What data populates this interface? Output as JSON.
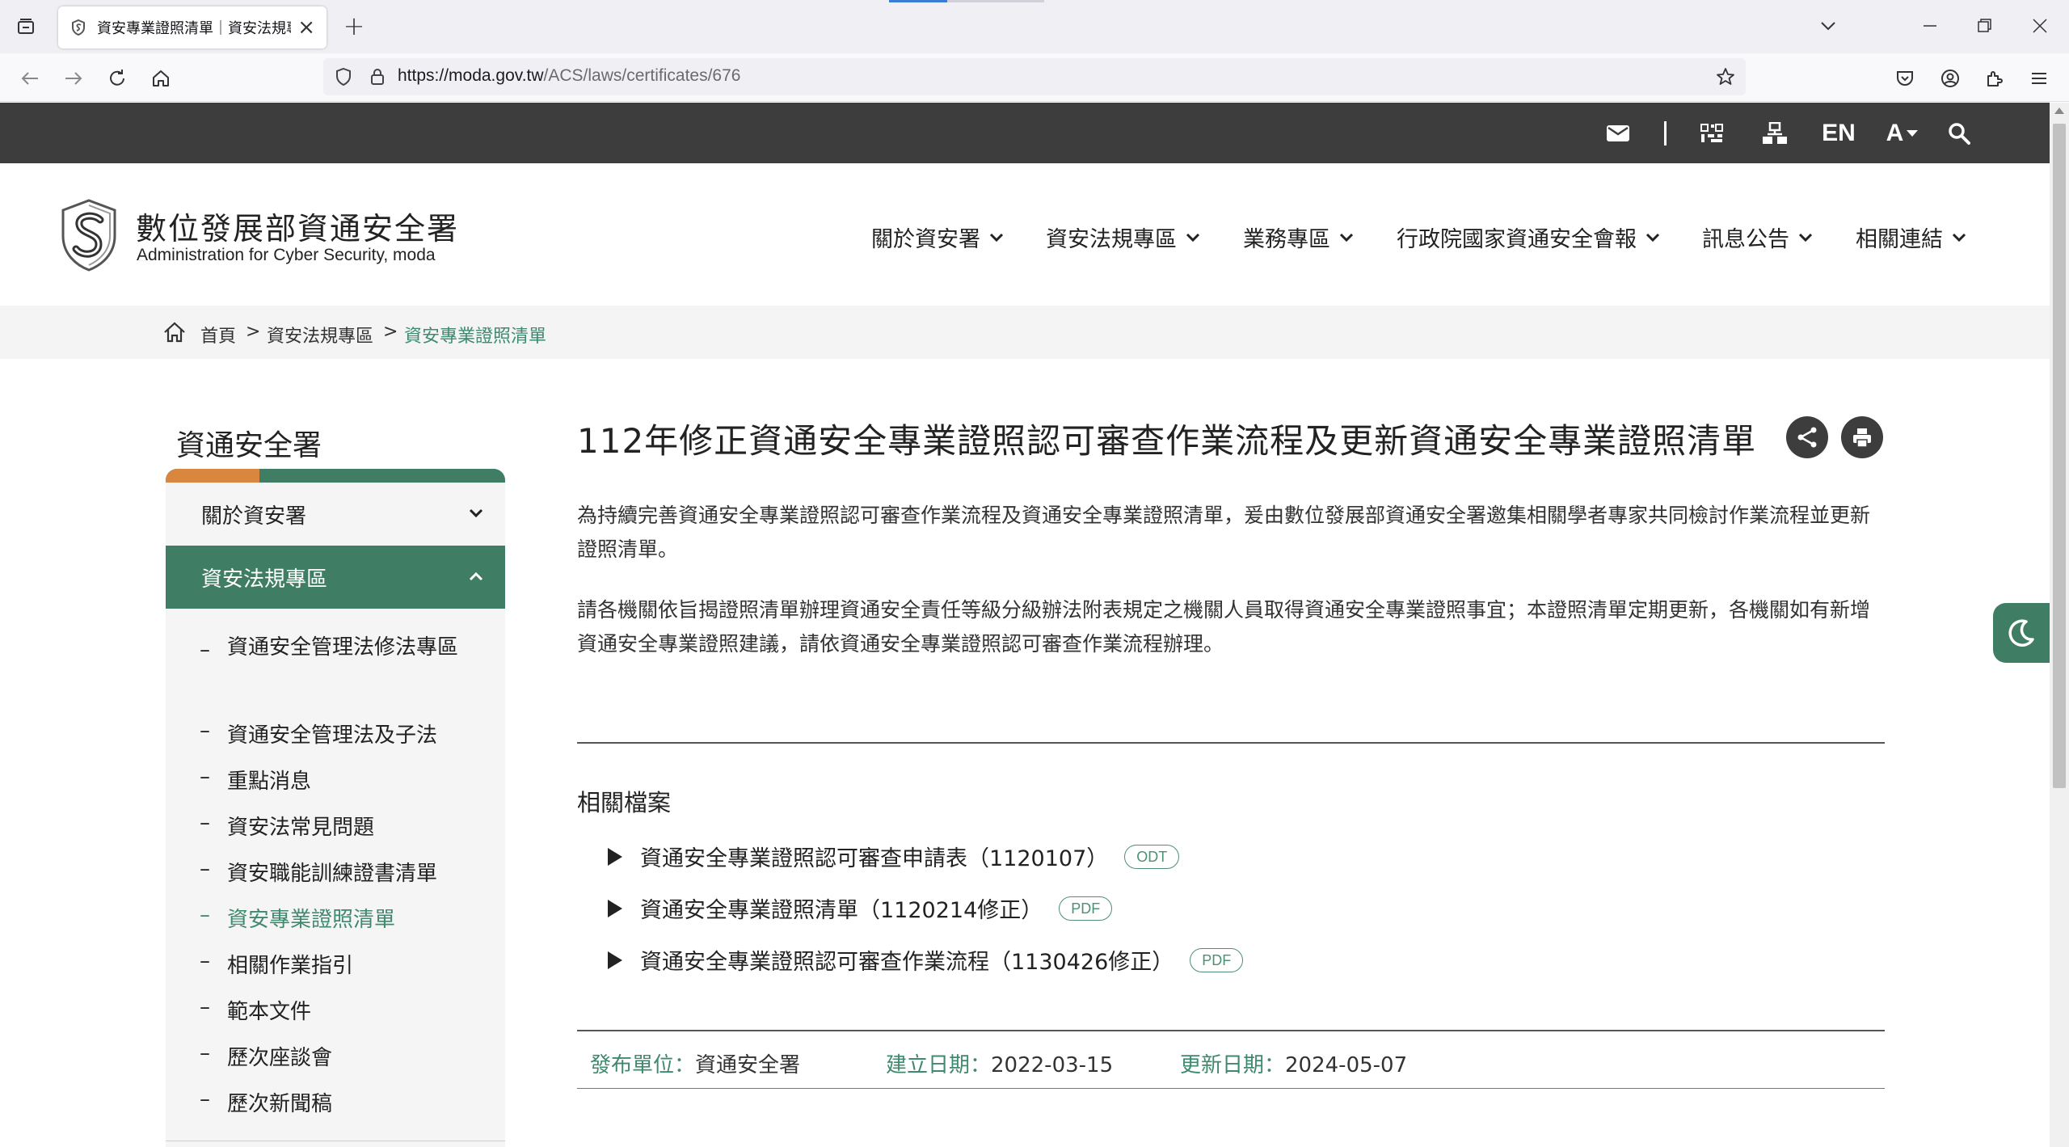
{
  "browser": {
    "tab_title": "資安專業證照清單｜資安法規專區",
    "tab_close": "×",
    "new_tab": "+",
    "url_host": "https://moda.gov.tw",
    "url_path": "/ACS/laws/certificates/676"
  },
  "topbar": {
    "lang": "EN",
    "font_size": "A"
  },
  "header": {
    "brand_zh": "數位發展部資通安全署",
    "brand_en": "Administration for Cyber Security, moda",
    "nav": [
      {
        "label": "關於資安署"
      },
      {
        "label": "資安法規專區"
      },
      {
        "label": "業務專區"
      },
      {
        "label": "行政院國家資通安全會報"
      },
      {
        "label": "訊息公告"
      },
      {
        "label": "相關連結"
      }
    ]
  },
  "breadcrumb": {
    "items": [
      "首頁",
      "資安法規專區",
      "資安專業證照清單"
    ],
    "separator": ">"
  },
  "sidebar": {
    "title": "資通安全署",
    "sections": [
      {
        "label": "關於資安署",
        "expanded": false
      },
      {
        "label": "資安法規專區",
        "expanded": true
      }
    ],
    "sub_items": [
      {
        "label": "資通安全管理法修法專區",
        "active": false
      },
      {
        "label": "資通安全管理法及子法",
        "active": false
      },
      {
        "label": "重點消息",
        "active": false
      },
      {
        "label": "資安法常見問題",
        "active": false
      },
      {
        "label": "資安職能訓練證書清單",
        "active": false
      },
      {
        "label": "資安專業證照清單",
        "active": true
      },
      {
        "label": "相關作業指引",
        "active": false
      },
      {
        "label": "範本文件",
        "active": false
      },
      {
        "label": "歷次座談會",
        "active": false
      },
      {
        "label": "歷次新聞稿",
        "active": false
      }
    ],
    "dash": "–"
  },
  "content": {
    "title": "112年修正資通安全專業證照認可審查作業流程及更新資通安全專業證照清單",
    "para1": "為持續完善資通安全專業證照認可審查作業流程及資通安全專業證照清單，爰由數位發展部資通安全署邀集相關學者專家共同檢討作業流程並更新證照清單。",
    "para2": "請各機關依旨揭證照清單辦理資通安全責任等級分級辦法附表規定之機關人員取得資通安全專業證照事宜；本證照清單定期更新，各機關如有新增資通安全專業證照建議，請依資通安全專業證照認可審查作業流程辦理。",
    "related_title": "相關檔案",
    "files": [
      {
        "name": "資通安全專業證照認可審查申請表（1120107）",
        "type": "ODT"
      },
      {
        "name": "資通安全專業證照清單（1120214修正）",
        "type": "PDF"
      },
      {
        "name": "資通安全專業證照認可審查作業流程（1130426修正）",
        "type": "PDF"
      }
    ],
    "meta": {
      "publisher_label": "發布單位：",
      "publisher": "資通安全署",
      "created_label": "建立日期：",
      "created": "2022-03-15",
      "updated_label": "更新日期：",
      "updated": "2024-05-07"
    }
  },
  "colors": {
    "accent_green": "#3f7e64",
    "accent_orange": "#d9873e",
    "topbar_dark": "#3d3d3d"
  }
}
